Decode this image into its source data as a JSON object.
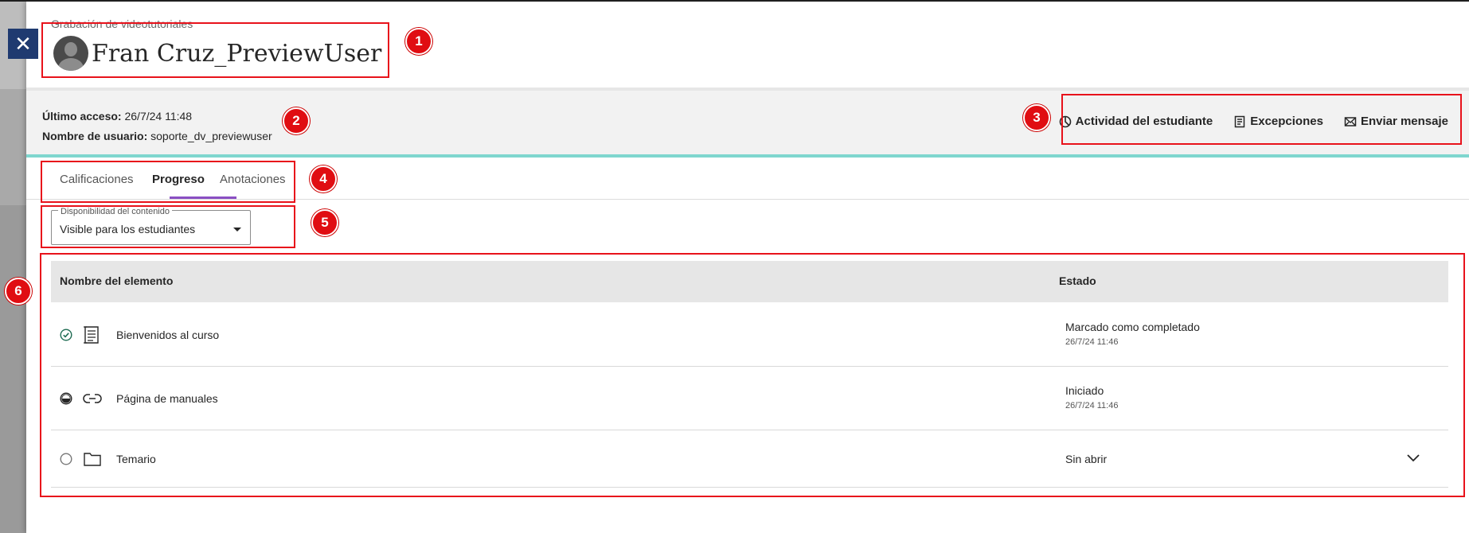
{
  "header": {
    "course_name": "Grabación de videotutoriales",
    "user_name": "Fran Cruz_PreviewUser"
  },
  "info": {
    "last_access_label": "Último acceso:",
    "last_access_value": "26/7/24 11:48",
    "username_label": "Nombre de usuario:",
    "username_value": "soporte_dv_previewuser"
  },
  "actions": {
    "activity": "Actividad del estudiante",
    "exceptions": "Excepciones",
    "message": "Enviar mensaje"
  },
  "tabs": [
    {
      "label": "Calificaciones",
      "active": false
    },
    {
      "label": "Progreso",
      "active": true
    },
    {
      "label": "Anotaciones",
      "active": false
    }
  ],
  "filter": {
    "legend": "Disponibilidad del contenido",
    "value": "Visible para los estudiantes"
  },
  "table": {
    "col_name": "Nombre del elemento",
    "col_status": "Estado",
    "rows": [
      {
        "name": "Bienvenidos al curso",
        "status": "Marcado como completado",
        "date": "26/7/24 11:46",
        "icon": "document-icon",
        "progress": "completed"
      },
      {
        "name": "Página de manuales",
        "status": "Iniciado",
        "date": "26/7/24 11:46",
        "icon": "link-icon",
        "progress": "started"
      },
      {
        "name": "Temario",
        "status": "Sin abrir",
        "date": "",
        "icon": "folder-icon",
        "progress": "not-opened"
      }
    ]
  },
  "annotations": [
    "1",
    "2",
    "3",
    "4",
    "5",
    "6"
  ],
  "colors": {
    "accent_tab": "#8a4fc3",
    "band_border": "#7fd6cf",
    "close_button": "#1f3a70",
    "annotation_red": "#e8121b"
  }
}
